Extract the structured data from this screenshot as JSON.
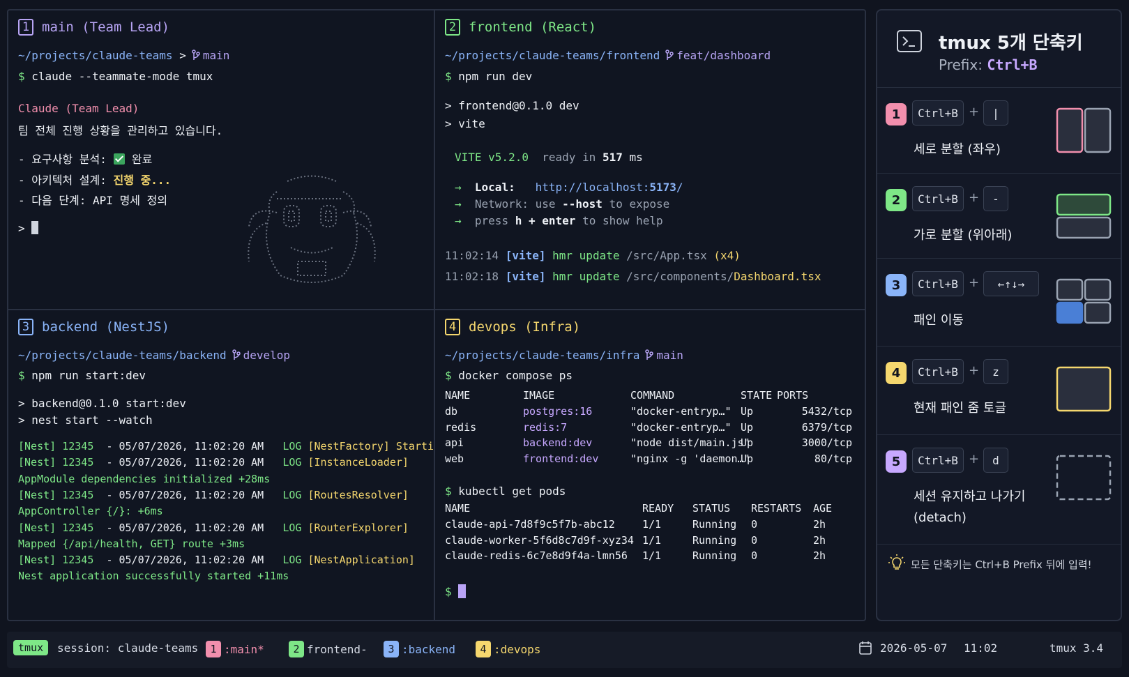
{
  "panes": {
    "p1": {
      "num": "1",
      "title": "main (Team Lead)",
      "path": "~/projects/claude-teams",
      "sep": ">",
      "branch": "main",
      "prompt": "$",
      "cmd": "claude --teammate-mode tmux",
      "agent": "Claude (Team Lead)",
      "status": "팀 전체 진행 상황을 관리하고 있습니다.",
      "task1_label": "- 요구사항 분석:",
      "task1_value": "완료",
      "task2_label": "- 아키텍처 설계:",
      "task2_value": "진행 중...",
      "task3": "- 다음 단계: API 명세 정의",
      "input_prompt": ">"
    },
    "p2": {
      "num": "2",
      "title": "frontend (React)",
      "path": "~/projects/claude-teams/frontend",
      "branch": "feat/dashboard",
      "prompt": "$",
      "cmd": "npm run dev",
      "out1": "> frontend@0.1.0 dev",
      "out2": "> vite",
      "vite": "VITE v5.2.0",
      "ready": "ready in",
      "ready_ms": "517",
      "ready_unit": "ms",
      "local_label": "Local:",
      "local_url": "http://localhost:",
      "local_port": "5173",
      "local_slash": "/",
      "network": "Network: use",
      "network_flag": "--host",
      "network_rest": "to expose",
      "press": "press",
      "press_key": "h + enter",
      "press_rest": "to show help",
      "arrow": "→",
      "log1_time": "11:02:14",
      "log1_tag": "[vite]",
      "log1_msg": "hmr update",
      "log1_path": "/src/App.tsx",
      "log1_count": "(x4)",
      "log2_time": "11:02:18",
      "log2_tag": "[vite]",
      "log2_msg": "hmr update",
      "log2_path": "/src/components/",
      "log2_file": "Dashboard.tsx"
    },
    "p3": {
      "num": "3",
      "title": "backend (NestJS)",
      "path": "~/projects/claude-teams/backend",
      "branch": "develop",
      "prompt": "$",
      "cmd": "npm run start:dev",
      "out1": "> backend@0.1.0 start:dev",
      "out2": "> nest start --watch",
      "logs": [
        {
          "pre": "[Nest] 12345",
          "date": "- 05/07/2026, 11:02:20 AM",
          "lvl": "LOG",
          "ctx": "[NestFactory] Starting"
        },
        {
          "pre": "[Nest] 12345",
          "date": "- 05/07/2026, 11:02:20 AM",
          "lvl": "LOG",
          "ctx": "[InstanceLoader]"
        },
        {
          "cont": "AppModule dependencies initialized +28ms"
        },
        {
          "pre": "[Nest] 12345",
          "date": "- 05/07/2026, 11:02:20 AM",
          "lvl": "LOG",
          "ctx": "[RoutesResolver]"
        },
        {
          "cont": "AppController {/}: +6ms"
        },
        {
          "pre": "[Nest] 12345",
          "date": "- 05/07/2026, 11:02:20 AM",
          "lvl": "LOG",
          "ctx": "[RouterExplorer]"
        },
        {
          "cont": "Mapped {/api/health, GET} route +3ms"
        },
        {
          "pre": "[Nest] 12345",
          "date": "- 05/07/2026, 11:02:20 AM",
          "lvl": "LOG",
          "ctx": "[NestApplication]"
        },
        {
          "cont": "Nest application successfully started +11ms"
        }
      ]
    },
    "p4": {
      "num": "4",
      "title": "devops (Infra)",
      "path": "~/projects/claude-teams/infra",
      "branch": "main",
      "prompt": "$",
      "cmd1": "docker compose ps",
      "compose_headers": [
        "NAME",
        "IMAGE",
        "COMMAND",
        "STATE",
        "PORTS"
      ],
      "compose_rows": [
        [
          "db",
          "postgres:16",
          "\"docker-entryp…\"",
          "Up",
          "5432/tcp"
        ],
        [
          "redis",
          "redis:7",
          "\"docker-entryp…\"",
          "Up",
          "6379/tcp"
        ],
        [
          "api",
          "backend:dev",
          "\"node dist/main.js\"",
          "Up",
          "3000/tcp"
        ],
        [
          "web",
          "frontend:dev",
          "\"nginx -g 'daemon…\"",
          "Up",
          "80/tcp"
        ]
      ],
      "cmd2": "kubectl get pods",
      "pod_headers": [
        "NAME",
        "READY",
        "STATUS",
        "RESTARTS",
        "AGE"
      ],
      "pod_rows": [
        [
          "claude-api-7d8f9c5f7b-abc12",
          "1/1",
          "Running",
          "0",
          "2h"
        ],
        [
          "claude-worker-5f6d8c7d9f-xyz34",
          "1/1",
          "Running",
          "0",
          "2h"
        ],
        [
          "claude-redis-6c7e8d9f4a-lmn56",
          "1/1",
          "Running",
          "0",
          "2h"
        ]
      ],
      "final_prompt": "$"
    }
  },
  "shortcuts": {
    "title": "tmux 5개 단축키",
    "prefix_label": "Prefix:",
    "prefix_value": "Ctrl+B",
    "plus": "+",
    "items": [
      {
        "num": "1",
        "key": "Ctrl+B",
        "key2": "|",
        "desc": "세로 분할 (좌우)",
        "color": "#f28fad"
      },
      {
        "num": "2",
        "key": "Ctrl+B",
        "key2": "-",
        "desc": "가로 분할 (위아래)",
        "color": "#7ee787"
      },
      {
        "num": "3",
        "key": "Ctrl+B",
        "key2": "←↑↓→",
        "desc": "패인 이동",
        "color": "#8ab4f8"
      },
      {
        "num": "4",
        "key": "Ctrl+B",
        "key2": "z",
        "desc": "현재 패인 줌 토글",
        "color": "#f5d76e"
      },
      {
        "num": "5",
        "key": "Ctrl+B",
        "key2": "d",
        "desc": "세션 유지하고 나가기",
        "desc2": "(detach)",
        "color": "#c7a8ff"
      }
    ],
    "tip": "모든 단축키는 Ctrl+B Prefix 뒤에 입력!"
  },
  "statusbar": {
    "tag": "tmux",
    "session": "session: claude-teams",
    "windows": [
      {
        "num": "1",
        "name": ":main*",
        "color": "#f28fad",
        "text_color": "#f28fad"
      },
      {
        "num": "2",
        "name": "frontend-",
        "color": "#7ee787",
        "text_color": "#d7dce6"
      },
      {
        "num": "3",
        "name": ":backend",
        "color": "#8ab4f8",
        "text_color": "#8ab4f8"
      },
      {
        "num": "4",
        "name": ":devops",
        "color": "#f5d76e",
        "text_color": "#f5d76e"
      }
    ],
    "date": "2026-05-07",
    "time": "11:02",
    "version": "tmux 3.4"
  },
  "colors": {
    "pane1": "#b7a4f4",
    "pane2": "#7ee787",
    "pane3": "#8ab4f8",
    "pane4": "#f5d76e"
  }
}
